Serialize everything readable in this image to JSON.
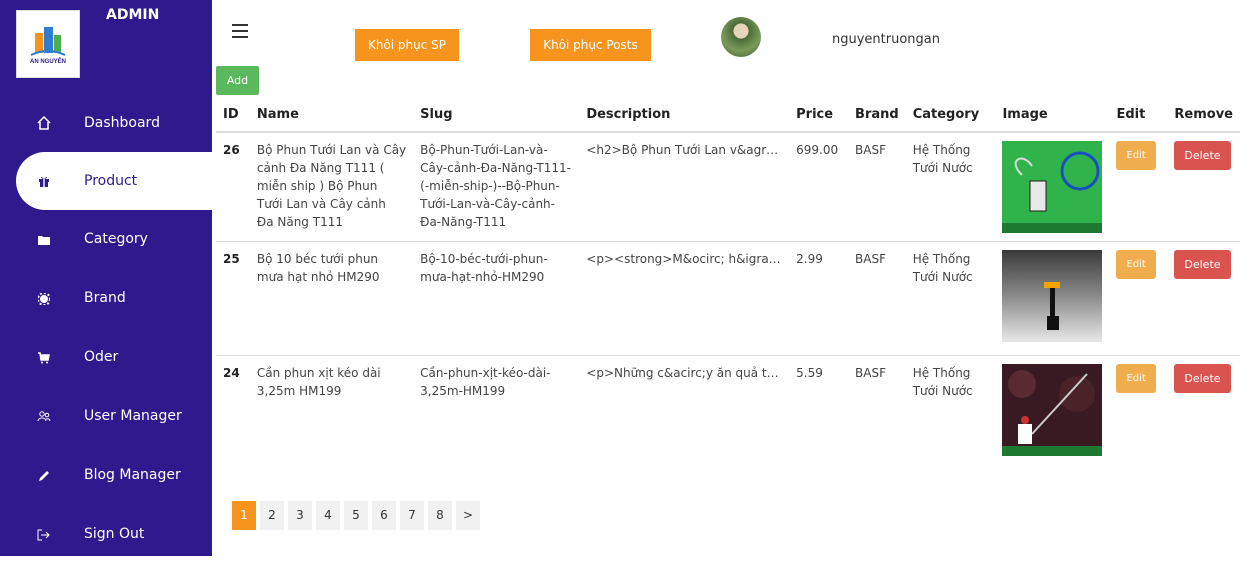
{
  "sidebar": {
    "admin_label": "ADMIN",
    "logo_text": "AN NGUYÊN",
    "items": [
      {
        "label": "Dashboard",
        "icon": "home-icon"
      },
      {
        "label": "Product",
        "icon": "gift-icon"
      },
      {
        "label": "Category",
        "icon": "folder-icon"
      },
      {
        "label": "Brand",
        "icon": "gear-icon"
      },
      {
        "label": "Oder",
        "icon": "cart-icon"
      },
      {
        "label": "User Manager",
        "icon": "users-icon"
      },
      {
        "label": "Blog Manager",
        "icon": "pencil-icon"
      },
      {
        "label": "Sign Out",
        "icon": "sign-out-icon"
      }
    ]
  },
  "header": {
    "restore_products_label": "Khôi phục SP",
    "restore_posts_label": "Khôi phục Posts",
    "username": "nguyentruongan"
  },
  "add_label": "Add",
  "table": {
    "columns": [
      "ID",
      "Name",
      "Slug",
      "Description",
      "Price",
      "Brand",
      "Category",
      "Image",
      "Edit",
      "Remove"
    ],
    "rows": [
      {
        "id": "26",
        "name": "Bộ Phun Tưới Lan và Cây cảnh Đa Năng T111 ( miễn ship ) Bộ Phun Tưới Lan và Cây cảnh Đa Năng T111",
        "slug": "Bộ-Phun-Tưới-Lan-và-Cây-cảnh-Đa-Năng-T111-(-miễn-ship-)--Bộ-Phun-Tưới-Lan-và-Cây-cảnh-Đa-Năng-T111",
        "description": "<h2>Bộ Phun Tưới Lan v&agr…",
        "price": "699.00",
        "brand": "BASF",
        "category": "Hệ Thống Tưới Nước",
        "edit": "Edit",
        "remove": "Delete"
      },
      {
        "id": "25",
        "name": "Bộ 10 béc tưới phun mưa hạt nhỏ HM290",
        "slug": "Bộ-10-béc-tưới-phun-mưa-hạt-nhỏ-HM290",
        "description": "<p><strong>M&ocirc; h&igra…",
        "price": "2.99",
        "brand": "BASF",
        "category": "Hệ Thống Tưới Nước",
        "edit": "Edit",
        "remove": "Delete"
      },
      {
        "id": "24",
        "name": "Cần phun xịt kéo dài 3,25m HM199",
        "slug": "Cần-phun-xịt-kéo-dài-3,25m-HM199",
        "description": "<p>Những c&acirc;y ăn quả t…",
        "price": "5.59",
        "brand": "BASF",
        "category": "Hệ Thống Tưới Nước",
        "edit": "Edit",
        "remove": "Delete"
      }
    ]
  },
  "pagination": [
    "1",
    "2",
    "3",
    "4",
    "5",
    "6",
    "7",
    "8",
    ">"
  ],
  "colors": {
    "sidebar": "#2e1a8c",
    "accent": "#f7941d",
    "add": "#5cb85c",
    "edit": "#f0ad4e",
    "delete": "#d9534f"
  }
}
